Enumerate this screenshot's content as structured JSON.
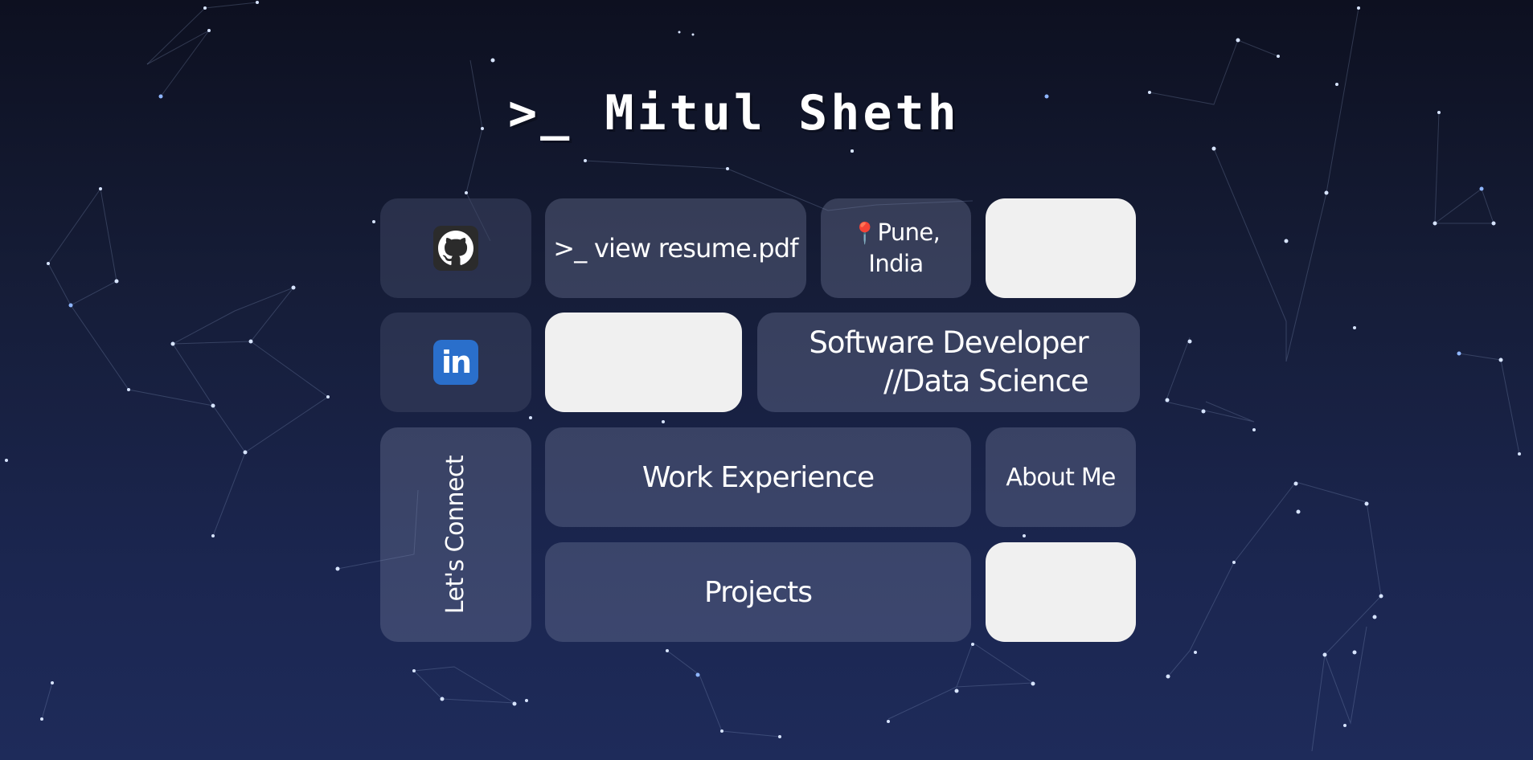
{
  "header": {
    "title": ">_ Mitul Sheth"
  },
  "tiles": {
    "resume_label": ">_ view resume.pdf",
    "location_pin": "📍",
    "location_line1": "Pune,",
    "location_line2": "India",
    "role_line1": "Software Developer",
    "role_line2": "//Data Science",
    "work_label": "Work Experience",
    "about_label": "About Me",
    "projects_label": "Projects",
    "connect_label": "Let's Connect"
  },
  "icons": {
    "github": "github-icon",
    "linkedin": "linkedin-icon"
  },
  "colors": {
    "tile": "#5a6385",
    "tile_light": "#f0f0f0",
    "github_bg": "#2b2b2b",
    "linkedin_bg": "#2a6fcb",
    "star": "#9fc4ff"
  }
}
